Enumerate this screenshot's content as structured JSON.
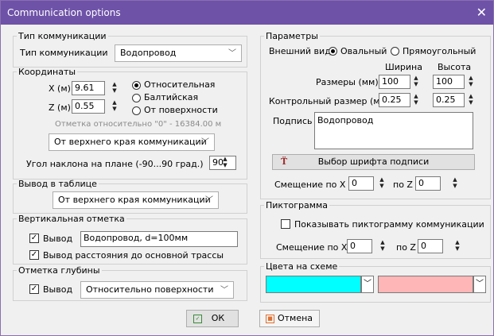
{
  "window": {
    "title": "Communication options",
    "close": "✕"
  },
  "comm_type": {
    "legend": "Тип коммуникации",
    "label": "Тип коммуникации",
    "value": "Водопровод"
  },
  "coords": {
    "legend": "Координаты",
    "x_label": "X (м)",
    "x_value": "9.61",
    "z_label": "Z (м)",
    "z_value": "0.55",
    "radio_relative": "Относительная",
    "radio_baltic": "Балтийская",
    "radio_surface": "От поверхности",
    "mark_note": "Отметка относительно \"0\" - 16384.00 м",
    "from_combo": "От верхнего края коммуникации",
    "angle_label": "Угол наклона на плане (-90...90 град.)",
    "angle_value": "90"
  },
  "table_output": {
    "legend": "Вывод в таблице",
    "value": "От верхнего края коммуникации"
  },
  "vertical_mark": {
    "legend": "Вертикальная отметка",
    "output_label": "Вывод",
    "output_text": "Водопровод, d=100мм",
    "distance_label": "Вывод расстояния до основной трассы"
  },
  "depth_mark": {
    "legend": "Отметка глубины",
    "output_label": "Вывод",
    "combo": "Относительно поверхности"
  },
  "params": {
    "legend": "Параметры",
    "appearance_label": "Внешний вид",
    "oval": "Овальный",
    "rect": "Прямоугольный",
    "width_header": "Ширина",
    "height_header": "Высота",
    "size_label": "Размеры (мм)",
    "size_w": "100",
    "size_h": "100",
    "control_label": "Контрольный размер (м)",
    "control_w": "0.25",
    "control_h": "0.25",
    "caption_label": "Подпись",
    "caption_text": "Водопровод",
    "font_button": "Выбор шрифта подписи",
    "offset_label": "Смещение по X",
    "offset_x": "0",
    "offset_z_label": "по Z",
    "offset_z": "0"
  },
  "pictogram": {
    "legend": "Пиктограмма",
    "show_label": "Показывать пиктограмму коммуникации",
    "offset_label": "Смещение по X",
    "offset_x": "0",
    "offset_z_label": "по Z",
    "offset_z": "0"
  },
  "colors": {
    "legend": "Цвета на схеме",
    "color1": "#00ffff",
    "color2": "#ffb6b6"
  },
  "buttons": {
    "ok": "ОК",
    "cancel": "Отмена"
  }
}
